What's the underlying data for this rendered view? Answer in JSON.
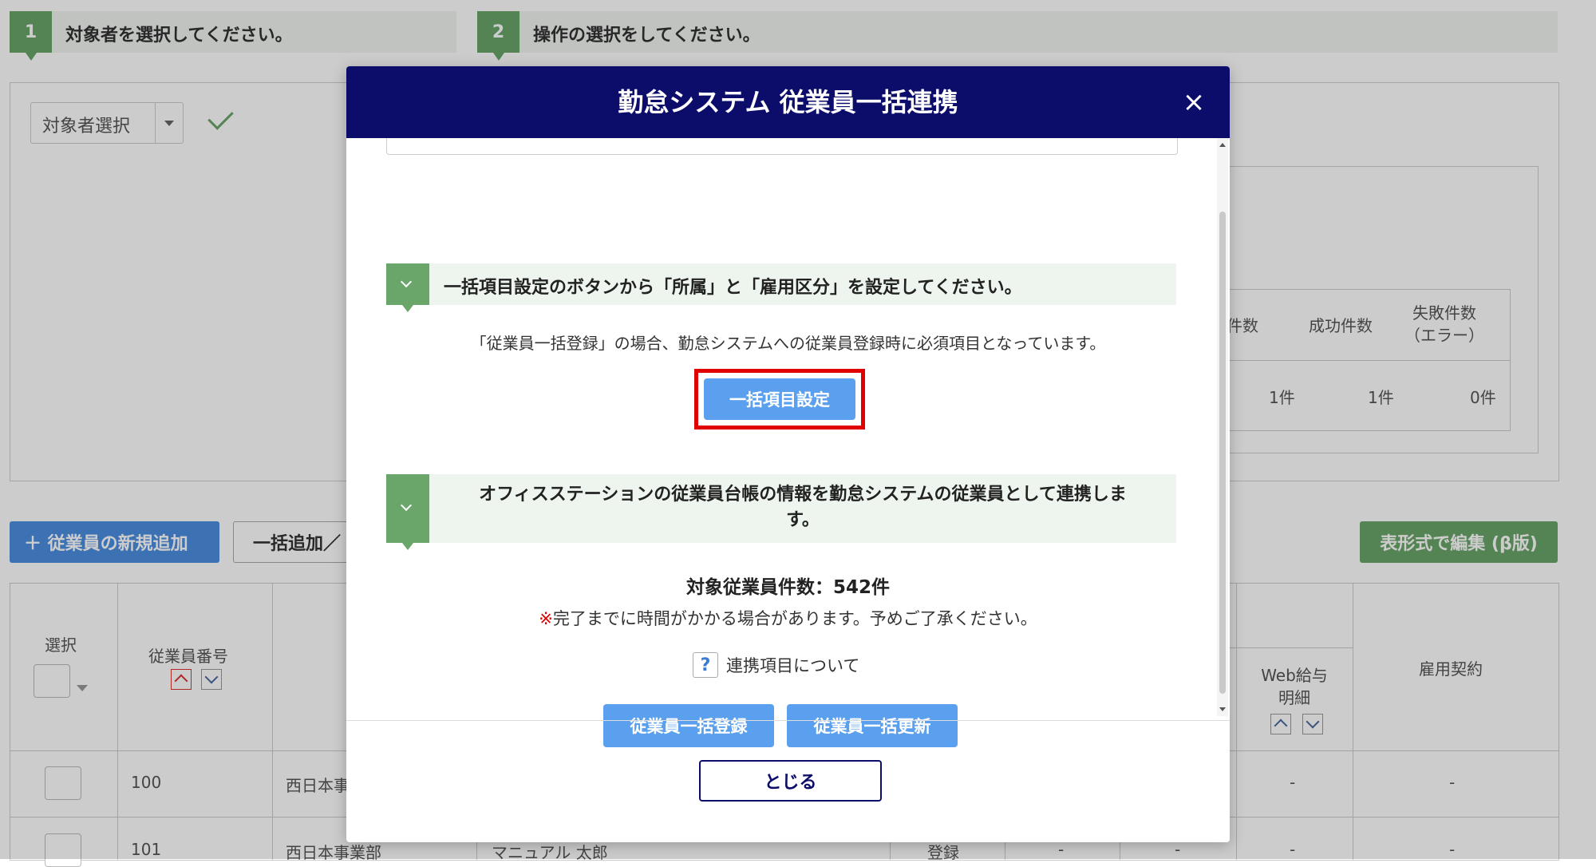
{
  "steps": [
    {
      "num": "1",
      "label": "対象者を選択してください。"
    },
    {
      "num": "2",
      "label": "操作の選択をしてください。"
    }
  ],
  "target_select": {
    "value": "対象者選択"
  },
  "summary_table": {
    "headers": [
      "件数",
      "成功件数",
      "失敗件数\n（エラー）"
    ],
    "values": [
      "1件",
      "1件",
      "0件"
    ]
  },
  "toolbar": {
    "add_employee": "＋ 従業員の新規追加",
    "bulk_add": "一括追加／",
    "table_edit": "表形式で編集 (β版)"
  },
  "grid": {
    "headers": {
      "select": "選択",
      "employee_no": "従業員番号",
      "web_payslip": "Web給与明細",
      "employment_contract": "雇用契約"
    },
    "rows": [
      {
        "no": "100",
        "dept": "西日本事",
        "name": "",
        "status": "",
        "web": "-",
        "contract": "-"
      },
      {
        "no": "101",
        "dept": "西日本事業部",
        "name": "マニュアル 太郎",
        "status": "登録",
        "c1": "-",
        "c2": "-",
        "web": "-",
        "contract": "-"
      }
    ]
  },
  "modal": {
    "title": "勤怠システム 従業員一括連携",
    "close_icon": "×",
    "section1": {
      "text": "一括項目設定のボタンから「所属」と「雇用区分」を設定してください。",
      "note": "「従業員一括登録」の場合、勤怠システムへの従業員登録時に必須項目となっています。",
      "button": "一括項目設定"
    },
    "section2": {
      "text_line1": "オフィスステーションの従業員台帳の情報を勤怠システムの従業員として連携しま",
      "text_line2": "す。",
      "count": "対象従業員件数：542件",
      "warning_mark": "※",
      "warning": "完了までに時間がかかる場合があります。予めご了承ください。",
      "help_icon": "?",
      "help_link": "連携項目について",
      "btn_register": "従業員一括登録",
      "btn_update": "従業員一括更新"
    },
    "close_button": "とじる"
  }
}
